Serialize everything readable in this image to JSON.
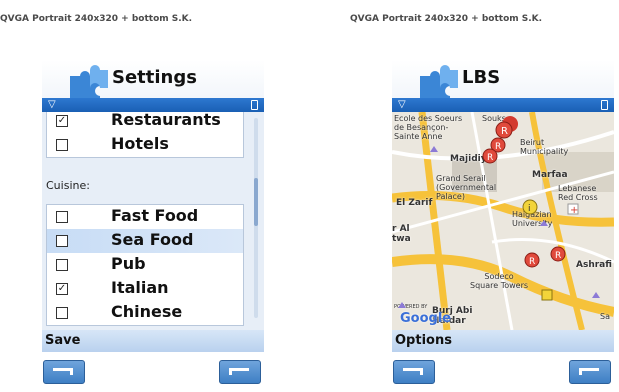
{
  "caption": "QVGA  Portrait  240x320  + bottom S.K.",
  "settings_screen": {
    "title": "Settings",
    "top_list": [
      {
        "label": "Restaurants",
        "checked": true
      },
      {
        "label": "Hotels",
        "checked": false
      }
    ],
    "cuisine_label": "Cuisine:",
    "cuisine_list": [
      {
        "label": "Fast Food",
        "checked": false,
        "selected": false
      },
      {
        "label": "Sea Food",
        "checked": false,
        "selected": true
      },
      {
        "label": "Pub",
        "checked": false,
        "selected": false
      },
      {
        "label": "Italian",
        "checked": true,
        "selected": false
      },
      {
        "label": "Chinese",
        "checked": false,
        "selected": false
      }
    ],
    "softkey_left": "Save"
  },
  "lbs_screen": {
    "title": "LBS",
    "map_labels": {
      "ecole": "Ecole des Soeurs\nde Besançon-\nSainte Anne",
      "souks": "Souks",
      "beirut": "Beirut\nMunicipality",
      "majidiye": "Majidiye",
      "grand_serail": "Grand Serail\n(Governmental\nPalace)",
      "marfaa": "Marfaa",
      "lebanese_red_cross": "Lebanese\nRed Cross",
      "el_zarif": "El Zarif",
      "haigazian": "Haigazian\nUniversity",
      "r_al": "r Al\ntwa",
      "ashrafi": "Ashrafi",
      "sodeco": "Sodeco\nSquare Towers",
      "burj_abi": "Burj Abi\nHaidar",
      "powered_by": "POWERED BY",
      "google": "Google",
      "sa": "Sa"
    },
    "softkey_left": "Options"
  }
}
